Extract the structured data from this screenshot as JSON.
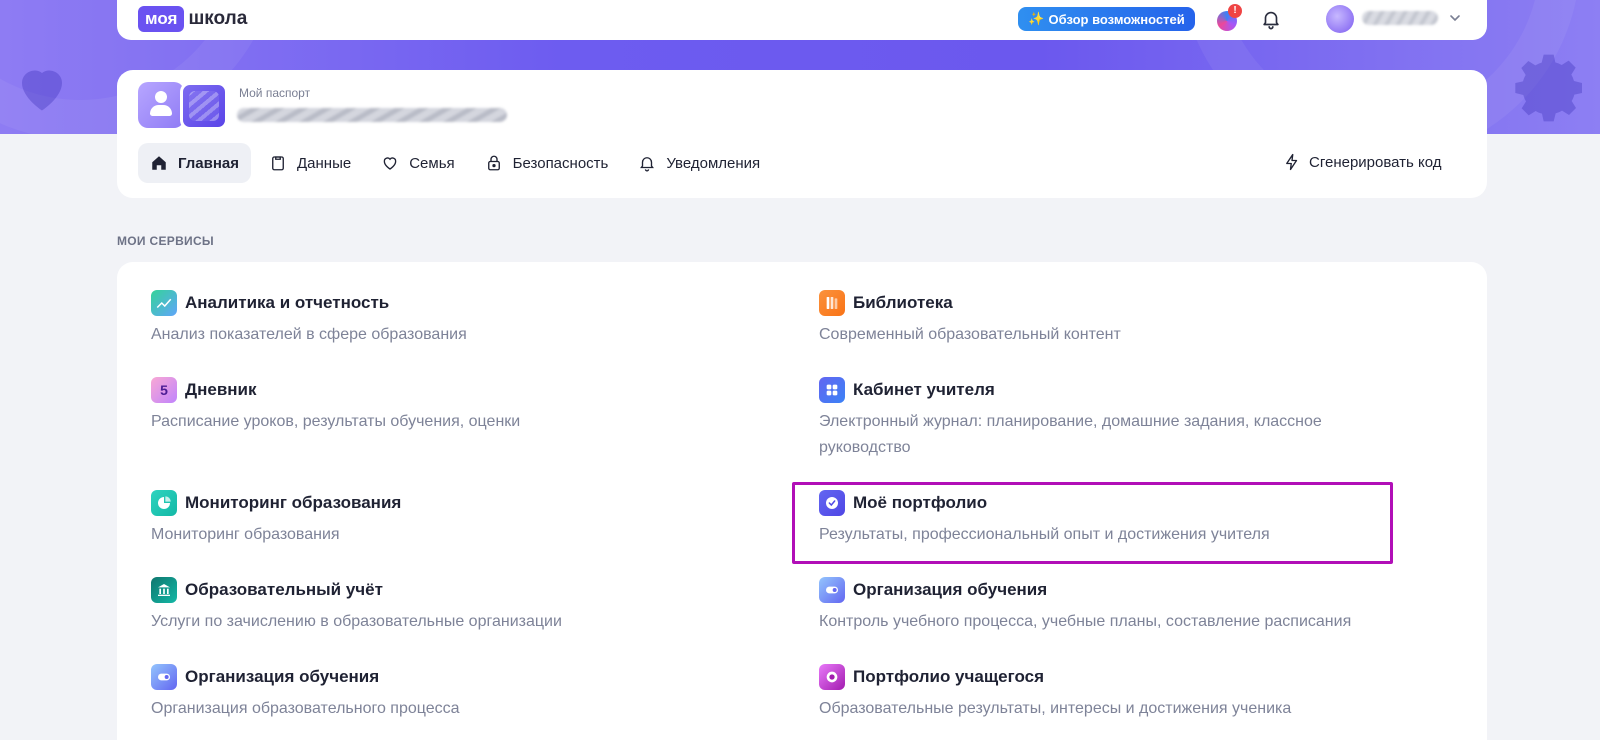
{
  "header": {
    "logo_badge": "моя",
    "logo_word": "школа",
    "overview_label": "Обзор возможностей",
    "assistant_badge": "!"
  },
  "passport": {
    "label": "Мой паспорт"
  },
  "tabs": [
    {
      "label": "Главная",
      "icon": "home-icon",
      "active": true
    },
    {
      "label": "Данные",
      "icon": "clipboard-icon",
      "active": false
    },
    {
      "label": "Семья",
      "icon": "heart-icon",
      "active": false
    },
    {
      "label": "Безопасность",
      "icon": "lock-icon",
      "active": false
    },
    {
      "label": "Уведомления",
      "icon": "bell-icon",
      "active": false
    }
  ],
  "generate_code_label": "Сгенерировать код",
  "services_section": {
    "title": "МОИ СЕРВИСЫ",
    "items": [
      {
        "title": "Аналитика и отчетность",
        "desc": "Анализ показателей в сфере образования",
        "icon": "analytics-icon"
      },
      {
        "title": "Библиотека",
        "desc": "Современный образовательный контент",
        "icon": "library-icon"
      },
      {
        "title": "Дневник",
        "desc": "Расписание уроков, результаты обучения, оценки",
        "icon": "diary-icon",
        "icon_text": "5"
      },
      {
        "title": "Кабинет учителя",
        "desc": "Электронный журнал: планирование, домашние задания, классное руководство",
        "icon": "teacher-cabinet-icon"
      },
      {
        "title": "Мониторинг образования",
        "desc": "Мониторинг образования",
        "icon": "monitoring-icon"
      },
      {
        "title": "Моё портфолио",
        "desc": "Результаты, профессиональный опыт и достижения учителя",
        "icon": "portfolio-icon"
      },
      {
        "title": "Образовательный учёт",
        "desc": "Услуги по зачислению в образовательные организации",
        "icon": "education-registry-icon"
      },
      {
        "title": "Организация обучения",
        "desc": "Контроль учебного процесса, учебные планы, составление расписания",
        "icon": "learning-organization-icon"
      },
      {
        "title": "Организация обучения",
        "desc": "Организация образовательного процесса",
        "icon": "learning-organization-icon"
      },
      {
        "title": "Портфолио учащегося",
        "desc": "Образовательные результаты, интересы и достижения ученика",
        "icon": "student-portfolio-icon"
      }
    ]
  },
  "colors": {
    "banner": "#6d5cf0",
    "highlight": "#b10fb7",
    "overview_button": "#2563eb"
  }
}
